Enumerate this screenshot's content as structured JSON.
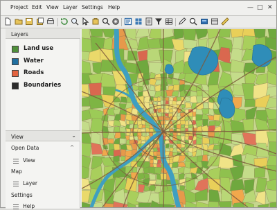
{
  "menubar": {
    "items": [
      "Project",
      "Edit",
      "View",
      "Layer",
      "Settings",
      "Help"
    ],
    "window_controls": {
      "minimize": "—",
      "maximize": "□",
      "close": "✕"
    }
  },
  "toolbar": {
    "icons": [
      "new-file-icon",
      "open-folder-icon",
      "save-icon",
      "save-as-icon",
      "print-icon",
      "refresh-icon",
      "zoom-in-icon",
      "select-arrow-icon",
      "pan-icon",
      "identify-icon",
      "gear-icon",
      "select-icon",
      "grid-icon",
      "calculator-icon",
      "filter-icon",
      "table-icon",
      "pen-icon",
      "search-icon",
      "settings-icon",
      "layer-stack-icon",
      "measure-icon"
    ]
  },
  "layers_panel": {
    "title": "Layers",
    "items": [
      {
        "label": "Land use",
        "color": "#4f8f3a"
      },
      {
        "label": "Water",
        "color": "#1f6fa0"
      },
      {
        "label": "Roads",
        "color": "#e3633f"
      },
      {
        "label": "Boundaries",
        "color": "#2b2b2b"
      }
    ]
  },
  "view_panel": {
    "title": "View",
    "sections": [
      {
        "label": "Open Data",
        "caret": "^",
        "item": "View"
      },
      {
        "label": "Map",
        "caret": "",
        "item": "Layer"
      },
      {
        "label": "Settings",
        "caret": "",
        "item": "Help"
      }
    ]
  },
  "map_colors": {
    "greens": [
      "#8fc14e",
      "#a9cf5c",
      "#b9d777",
      "#7eb544",
      "#c4dc8a",
      "#9ccb57",
      "#6fa83e"
    ],
    "yellows": [
      "#ead96a",
      "#f0e387",
      "#e9cf59"
    ],
    "oranges": [
      "#f1a84c",
      "#e6994b"
    ],
    "reds": [
      "#e0745a",
      "#d9684f"
    ],
    "water": "#3f9fc0",
    "lake": "#2f8db8",
    "road": "#7c5a3c"
  }
}
